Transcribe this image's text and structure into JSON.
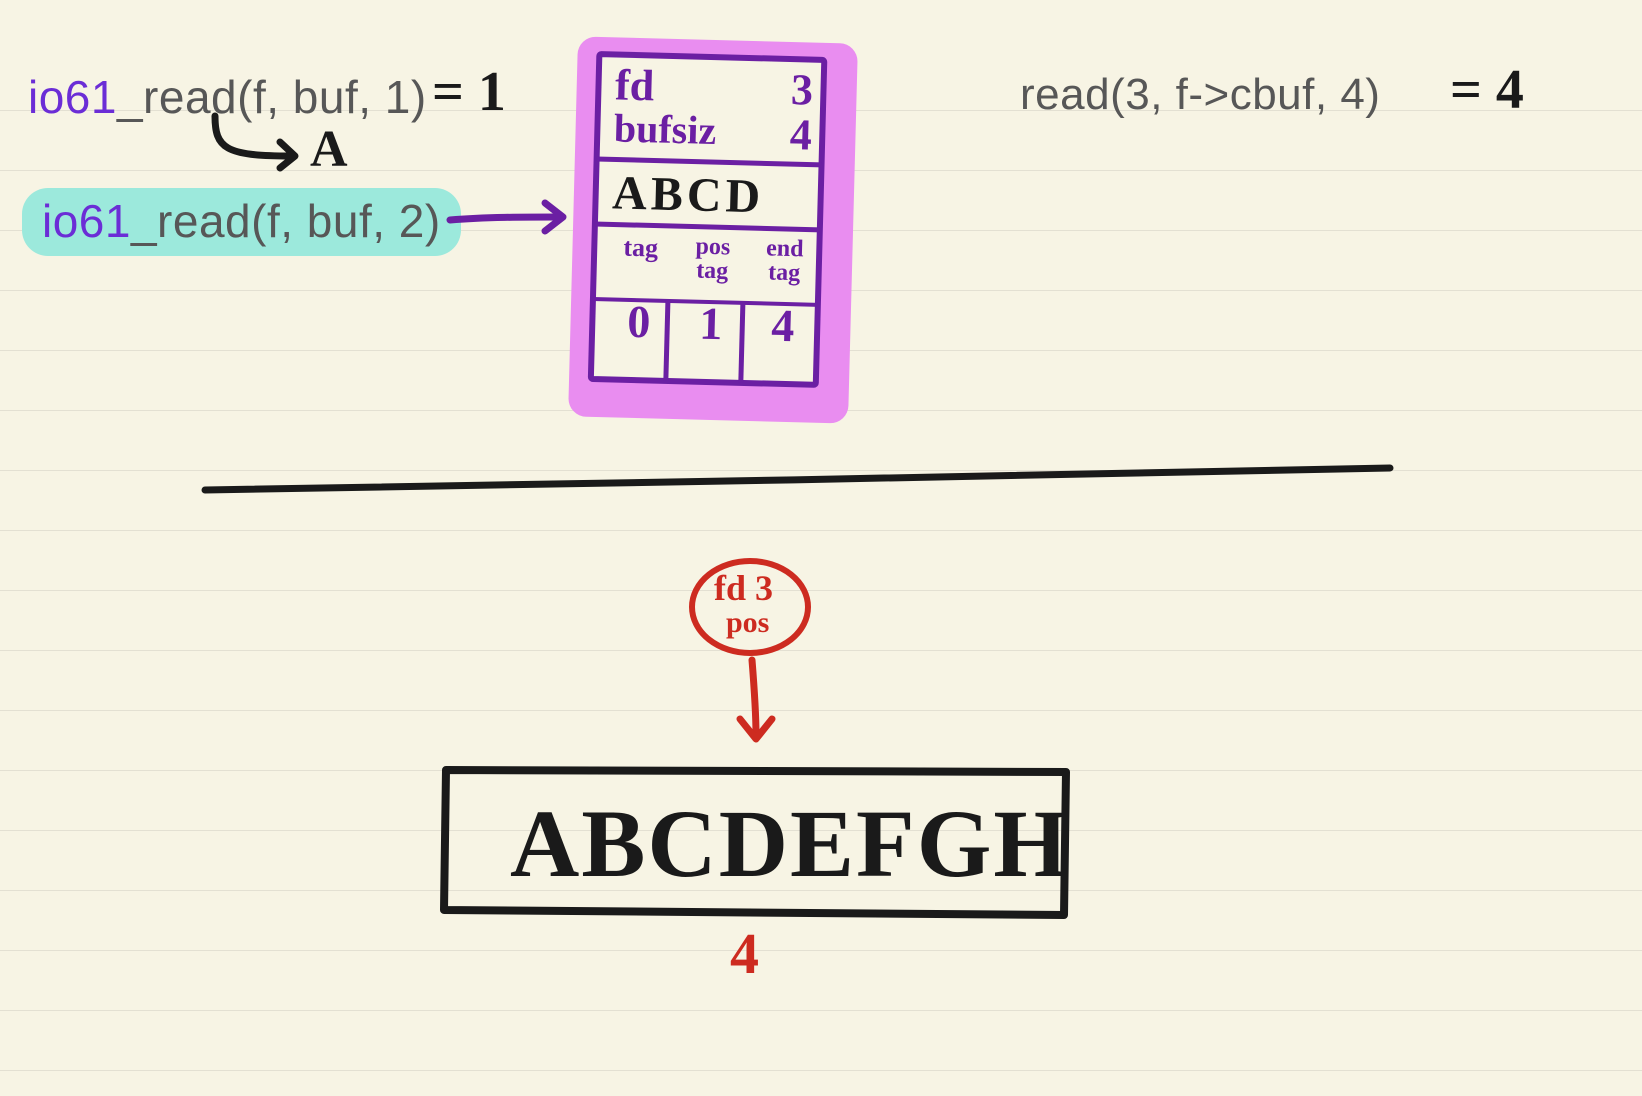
{
  "call1": {
    "prefix": "io61",
    "rest": "_read(f, buf, 1)",
    "equals": "= 1",
    "return_char": "A"
  },
  "call2": {
    "prefix": "io61",
    "rest": "_read(f, buf, 2)"
  },
  "syscall": {
    "text": "read(3, f->cbuf, 4)",
    "equals": "= 4"
  },
  "struct": {
    "fd_label": "fd",
    "fd_value": "3",
    "bufsiz_label": "bufsiz",
    "bufsiz_value": "4",
    "buffer": "ABCD",
    "tag_label": "tag",
    "postag_label": "pos\ntag",
    "endtag_label": "end\ntag",
    "tag_value": "0",
    "postag_value": "1",
    "endtag_value": "4"
  },
  "fdpos": {
    "label_line1": "fd 3",
    "label_line2": "pos"
  },
  "file": {
    "contents": "ABCDEFGH",
    "pos_marker": "4"
  }
}
